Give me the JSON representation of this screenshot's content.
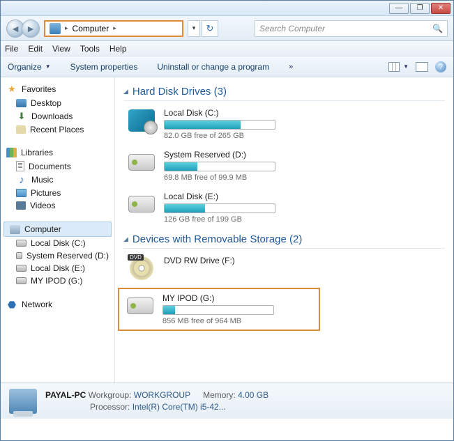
{
  "window": {
    "minimize": "—",
    "maximize": "❐",
    "close": "✕"
  },
  "address": {
    "location": "Computer",
    "sep": "▸"
  },
  "search": {
    "placeholder": "Search Computer"
  },
  "menu": {
    "file": "File",
    "edit": "Edit",
    "view": "View",
    "tools": "Tools",
    "help": "Help"
  },
  "toolbar": {
    "organize": "Organize",
    "system_properties": "System properties",
    "uninstall": "Uninstall or change a program",
    "more": "»"
  },
  "sidebar": {
    "favorites": {
      "label": "Favorites",
      "items": [
        {
          "label": "Desktop",
          "icon": "ic-desk"
        },
        {
          "label": "Downloads",
          "icon": "ic-dl"
        },
        {
          "label": "Recent Places",
          "icon": "ic-recent"
        }
      ]
    },
    "libraries": {
      "label": "Libraries",
      "items": [
        {
          "label": "Documents",
          "icon": "ic-doc"
        },
        {
          "label": "Music",
          "icon": "ic-music"
        },
        {
          "label": "Pictures",
          "icon": "ic-pic"
        },
        {
          "label": "Videos",
          "icon": "ic-vid"
        }
      ]
    },
    "computer": {
      "label": "Computer",
      "items": [
        {
          "label": "Local Disk (C:)",
          "icon": "ic-hdd"
        },
        {
          "label": "System Reserved (D:)",
          "icon": "ic-hdd"
        },
        {
          "label": "Local Disk (E:)",
          "icon": "ic-hdd"
        },
        {
          "label": "MY IPOD (G:)",
          "icon": "ic-hdd"
        }
      ]
    },
    "network": {
      "label": "Network"
    }
  },
  "groups": {
    "hdd": {
      "title": "Hard Disk Drives (3)",
      "drives": [
        {
          "name": "Local Disk (C:)",
          "free": "82.0 GB free of 265 GB",
          "fill_pct": 69,
          "icon": "drv-sys"
        },
        {
          "name": "System Reserved (D:)",
          "free": "69.8 MB free of 99.9 MB",
          "fill_pct": 30,
          "icon": "drv-hdd"
        },
        {
          "name": "Local Disk (E:)",
          "free": "126 GB free of 199 GB",
          "fill_pct": 37,
          "icon": "drv-hdd"
        }
      ]
    },
    "removable": {
      "title": "Devices with Removable Storage (2)",
      "dvd": {
        "name": "DVD RW Drive (F:)"
      },
      "ipod": {
        "name": "MY IPOD (G:)",
        "free": "856 MB free of 964 MB",
        "fill_pct": 11
      }
    }
  },
  "status": {
    "name": "PAYAL-PC",
    "workgroup_label": "Workgroup:",
    "workgroup_value": "WORKGROUP",
    "memory_label": "Memory:",
    "memory_value": "4.00 GB",
    "processor_label": "Processor:",
    "processor_value": "Intel(R) Core(TM) i5-42..."
  }
}
